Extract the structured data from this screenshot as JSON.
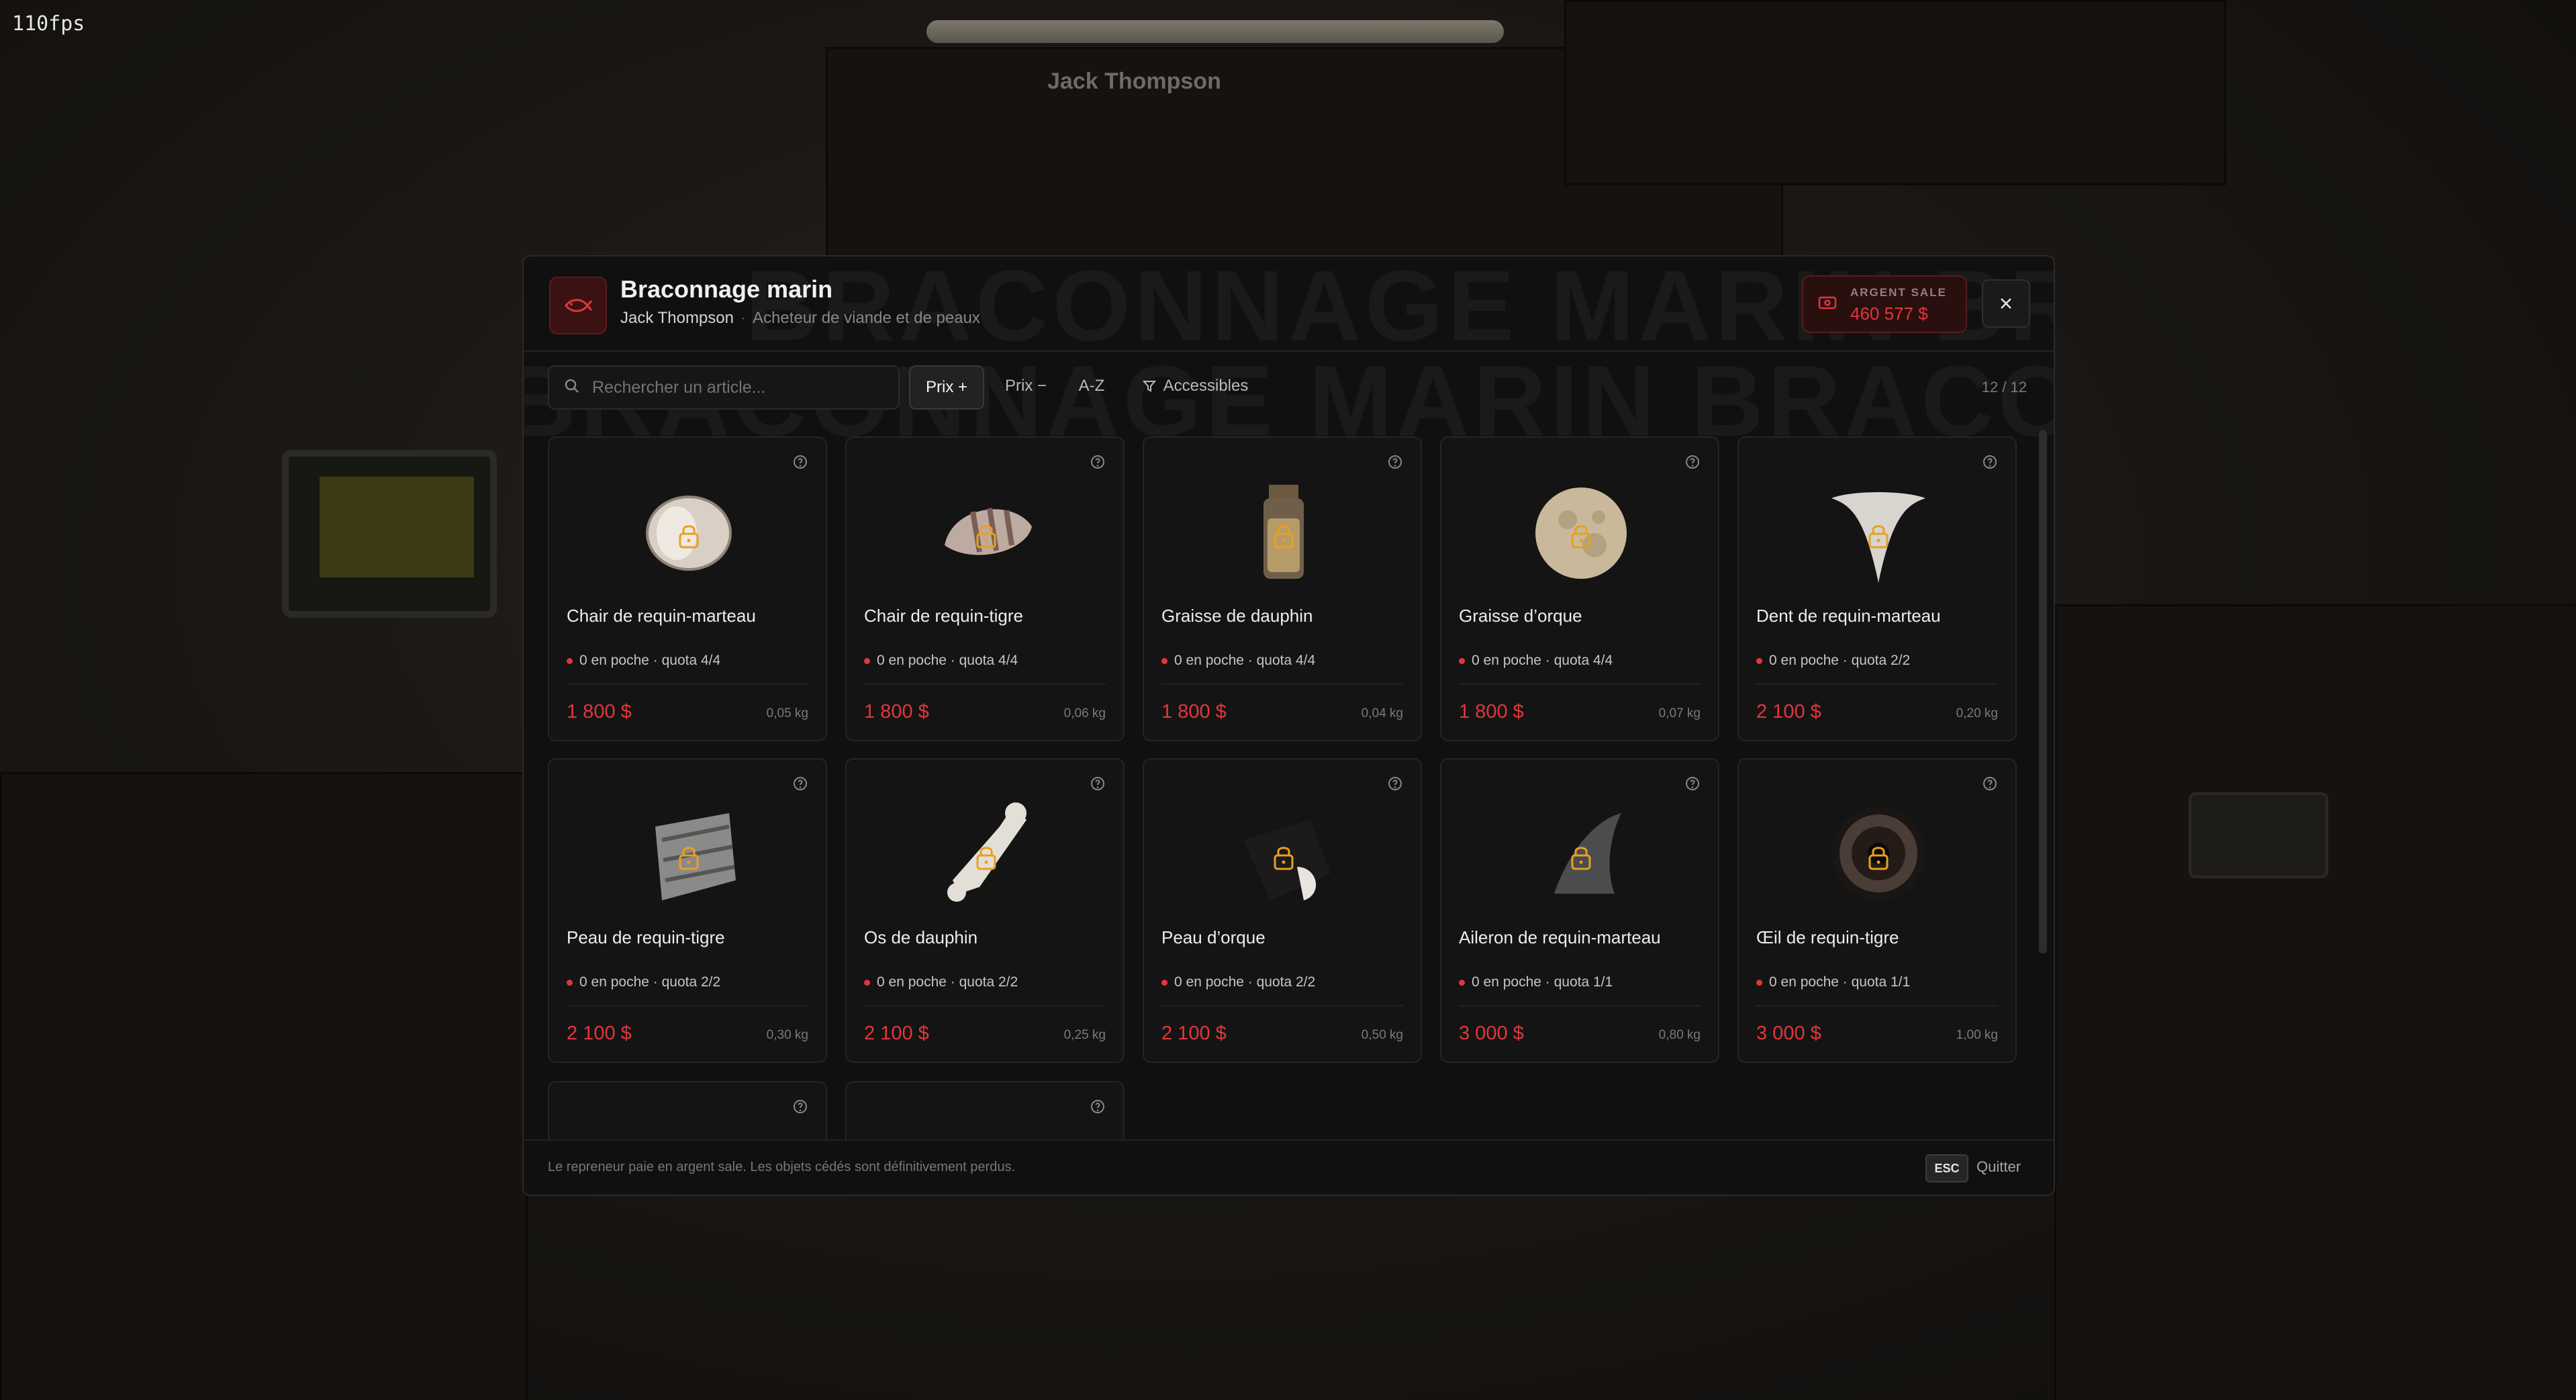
{
  "overlay": {
    "fps": "110fps",
    "npc_name": "Jack Thompson"
  },
  "header": {
    "title": "Braconnage marin",
    "npc": "Jack Thompson",
    "separator": "·",
    "subtitle": "Acheteur de viande et de peaux",
    "watermark": "BRACONNAGE MARIN BRACONNAGE MARIN BRACONN",
    "money_label": "ARGENT SALE",
    "money_value": "460 577 $",
    "icon": "fish-icon"
  },
  "toolbar": {
    "search_placeholder": "Rechercher un article...",
    "sort_options": [
      "Prix +",
      "Prix −",
      "A-Z"
    ],
    "active_sort": "Prix +",
    "filter_label": "Accessibles",
    "count": "12 / 12"
  },
  "items": [
    {
      "name": "Chair de requin-marteau",
      "quota": "0 en poche · quota 4/4",
      "price": "1 800 $",
      "weight": "0,05 kg",
      "icon": "shark-meat-icon"
    },
    {
      "name": "Chair de requin-tigre",
      "quota": "0 en poche · quota 4/4",
      "price": "1 800 $",
      "weight": "0,06 kg",
      "icon": "tiger-shark-meat-icon"
    },
    {
      "name": "Graisse de dauphin",
      "quota": "0 en poche · quota 4/4",
      "price": "1 800 $",
      "weight": "0,04 kg",
      "icon": "fat-jar-icon"
    },
    {
      "name": "Graisse d’orque",
      "quota": "0 en poche · quota 4/4",
      "price": "1 800 $",
      "weight": "0,07 kg",
      "icon": "orca-fat-icon"
    },
    {
      "name": "Dent de requin-marteau",
      "quota": "0 en poche · quota 2/2",
      "price": "2 100 $",
      "weight": "0,20 kg",
      "icon": "shark-tooth-icon"
    },
    {
      "name": "Peau de requin-tigre",
      "quota": "0 en poche · quota 2/2",
      "price": "2 100 $",
      "weight": "0,30 kg",
      "icon": "shark-skin-icon"
    },
    {
      "name": "Os de dauphin",
      "quota": "0 en poche · quota 2/2",
      "price": "2 100 $",
      "weight": "0,25 kg",
      "icon": "dolphin-bone-icon"
    },
    {
      "name": "Peau d’orque",
      "quota": "0 en poche · quota 2/2",
      "price": "2 100 $",
      "weight": "0,50 kg",
      "icon": "orca-skin-icon"
    },
    {
      "name": "Aileron de requin-marteau",
      "quota": "0 en poche · quota 1/1",
      "price": "3 000 $",
      "weight": "0,80 kg",
      "icon": "shark-fin-icon"
    },
    {
      "name": "Œil de requin-tigre",
      "quota": "0 en poche · quota 1/1",
      "price": "3 000 $",
      "weight": "1,00 kg",
      "icon": "shark-eye-icon"
    }
  ],
  "footer": {
    "note": "Le repreneur paie en argent sale. Les objets cédés sont définitivement perdus.",
    "esc_key": "ESC",
    "quit_label": "Quitter"
  },
  "colors": {
    "accent": "#e2363b",
    "lock": "#e8a020",
    "panel": "#101010",
    "card": "#141414"
  }
}
